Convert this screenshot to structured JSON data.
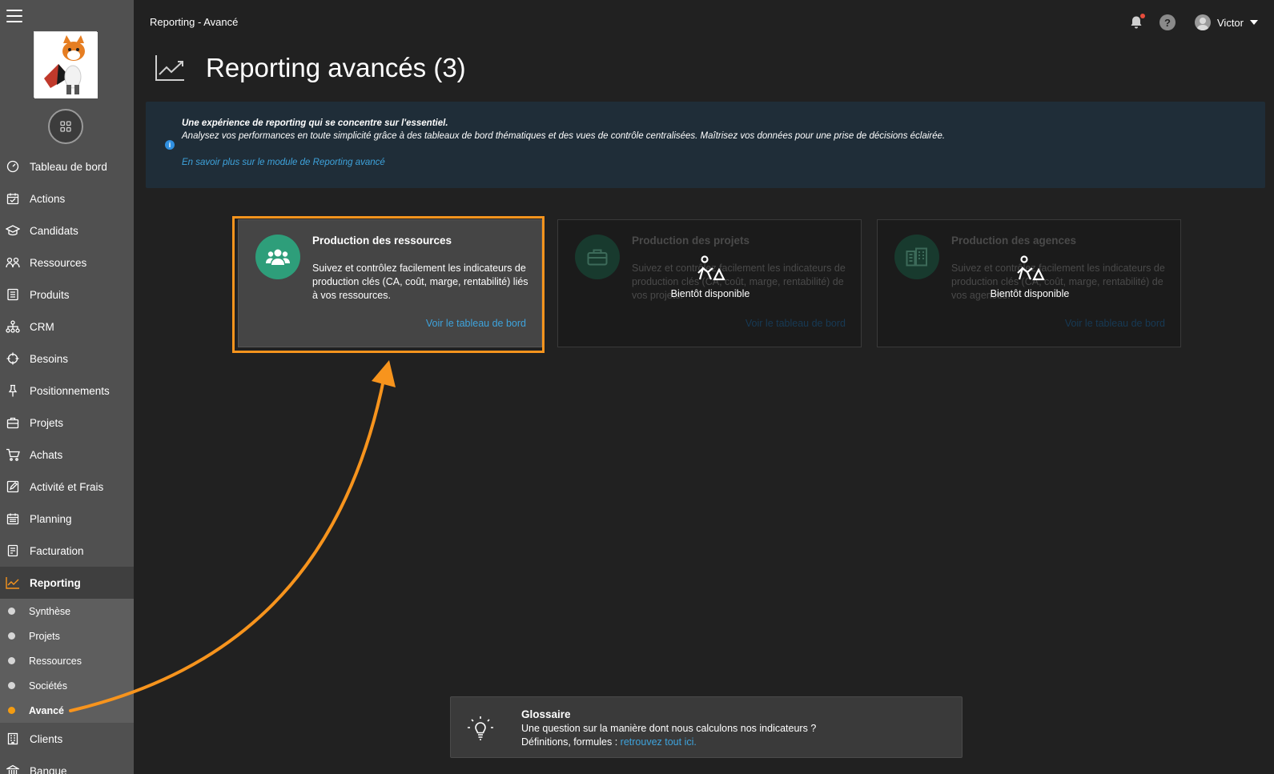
{
  "topbar": {
    "breadcrumb": "Reporting - Avancé",
    "user_name": "Victor"
  },
  "header": {
    "title": "Reporting avancés (3)",
    "icon": "trend-chart-icon"
  },
  "sidebar": {
    "items": [
      {
        "label": "Tableau de bord",
        "icon": "dashboard-icon"
      },
      {
        "label": "Actions",
        "icon": "calendar-check-icon"
      },
      {
        "label": "Candidats",
        "icon": "graduation-cap-icon"
      },
      {
        "label": "Ressources",
        "icon": "users-icon"
      },
      {
        "label": "Produits",
        "icon": "list-icon"
      },
      {
        "label": "CRM",
        "icon": "sitemap-icon"
      },
      {
        "label": "Besoins",
        "icon": "crosshair-icon"
      },
      {
        "label": "Positionnements",
        "icon": "pin-icon"
      },
      {
        "label": "Projets",
        "icon": "briefcase-icon"
      },
      {
        "label": "Achats",
        "icon": "cart-icon"
      },
      {
        "label": "Activité et Frais",
        "icon": "edit-icon"
      },
      {
        "label": "Planning",
        "icon": "calendar-icon"
      },
      {
        "label": "Facturation",
        "icon": "invoice-icon"
      },
      {
        "label": "Reporting",
        "icon": "chart-line-icon"
      }
    ],
    "reporting_sub": [
      {
        "label": "Synthèse"
      },
      {
        "label": "Projets"
      },
      {
        "label": "Ressources"
      },
      {
        "label": "Sociétés"
      },
      {
        "label": "Avancé"
      }
    ],
    "after_items": [
      {
        "label": "Clients",
        "icon": "building-icon"
      },
      {
        "label": "Banque",
        "icon": "bank-icon"
      }
    ]
  },
  "info": {
    "line1": "Une expérience de reporting qui se concentre sur l'essentiel.",
    "line2": "Analysez vos performances en toute simplicité grâce à des tableaux de bord thématiques et des vues de contrôle centralisées. Maîtrisez vos données pour une prise de décisions éclairée.",
    "link": "En savoir plus sur le module de Reporting avancé"
  },
  "cards": [
    {
      "title": "Production des ressources",
      "description": "Suivez et contrôlez facilement les indicateurs de production clés (CA, coût, marge, rentabilité) liés à vos ressources.",
      "link": "Voir le tableau de bord",
      "icon": "users-icon",
      "enabled": true
    },
    {
      "title": "Production des projets",
      "description": "Suivez et contrôlez facilement les indicateurs de production clés (CA, coût, marge, rentabilité) de vos projets.",
      "link": "Voir le tableau de bord",
      "icon": "briefcase-icon",
      "soon": "Bientôt disponible",
      "enabled": false
    },
    {
      "title": "Production des agences",
      "description": "Suivez et contrôlez facilement les indicateurs de production clés (CA, coût, marge, rentabilité) de vos agences.",
      "link": "Voir le tableau de bord",
      "icon": "buildings-icon",
      "soon": "Bientôt disponible",
      "enabled": false
    }
  ],
  "glossaire": {
    "title": "Glossaire",
    "line1": "Une question sur la manière dont nous calculons nos indicateurs ?",
    "line2_prefix": "Définitions, formules : ",
    "link": "retrouvez tout ici."
  },
  "colors": {
    "accent_orange": "#f7941d",
    "link_blue": "#3ea3dc",
    "card_green": "#2e9e7a"
  }
}
